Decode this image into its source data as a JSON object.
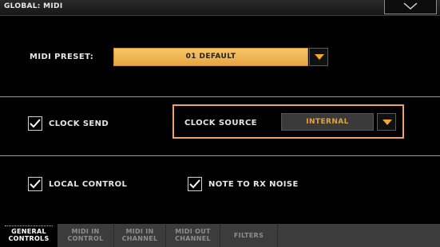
{
  "header": {
    "title": "GLOBAL: MIDI",
    "menu_icon": "chevron-down-icon"
  },
  "midi_preset": {
    "label": "MIDI PRESET:",
    "value": "01 DEFAULT"
  },
  "clock": {
    "send_label": "CLOCK SEND",
    "send_checked": true,
    "source_label": "CLOCK SOURCE",
    "source_value": "INTERNAL"
  },
  "options": {
    "local_control_label": "LOCAL CONTROL",
    "local_control_checked": true,
    "note_rx_noise_label": "NOTE TO RX NOISE",
    "note_rx_noise_checked": true
  },
  "tabs": [
    {
      "line1": "GENERAL",
      "line2": "CONTROLS",
      "active": true
    },
    {
      "line1": "MIDI IN",
      "line2": "CONTROL",
      "active": false
    },
    {
      "line1": "MIDI IN",
      "line2": "CHANNEL",
      "active": false
    },
    {
      "line1": "MIDI OUT",
      "line2": "CHANNEL",
      "active": false
    },
    {
      "line1": "FILTERS",
      "line2": "",
      "active": false
    }
  ],
  "colors": {
    "accent_orange": "#e7a640",
    "highlight_outline": "#f0a070",
    "source_text": "#e2a23c"
  }
}
